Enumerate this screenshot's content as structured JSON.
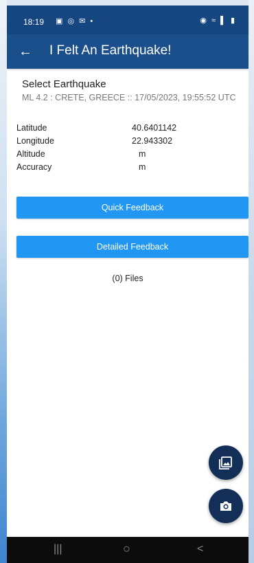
{
  "status_bar": {
    "time": "18:19",
    "left_icons": "▣ ◎ ✉ •",
    "right_icons": "◉ ≈ ▌ ▮"
  },
  "app_bar": {
    "title": "I Felt An Earthquake!",
    "back_icon": "←",
    "background": "#1a4f8c"
  },
  "earthquake": {
    "section_title": "Select Earthquake",
    "selected": "ML 4.2 : CRETE, GREECE :: 17/05/2023, 19:55:52 UTC"
  },
  "location": {
    "latitude_label": "Latitude",
    "latitude_value": "40.6401142",
    "longitude_label": "Longitude",
    "longitude_value": "22.943302",
    "altitude_label": "Altitude",
    "altitude_value": "m",
    "accuracy_label": "Accuracy",
    "accuracy_value": "m"
  },
  "actions": {
    "quick_feedback": "Quick Feedback",
    "detailed_feedback": "Detailed Feedback",
    "button_color": "#2196f3"
  },
  "files": {
    "label": "(0) Files"
  },
  "fabs": {
    "gallery_icon": "image-icon",
    "camera_icon": "camera-icon"
  },
  "nav_bar": {
    "recents": "|||",
    "home": "○",
    "back": "<"
  }
}
